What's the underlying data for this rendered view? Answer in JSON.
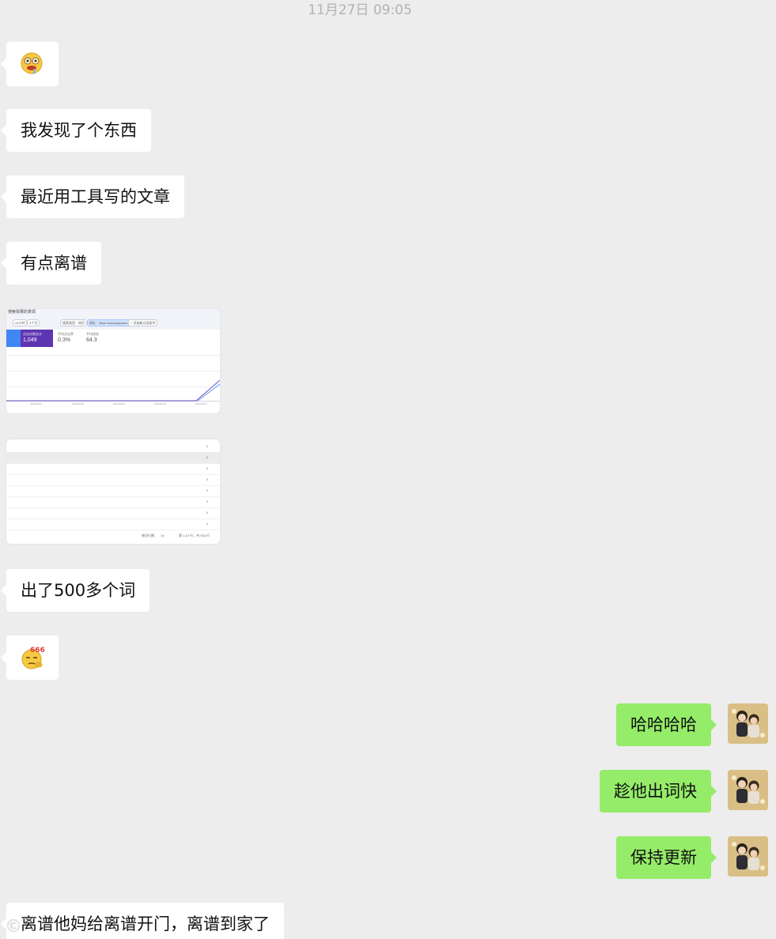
{
  "timestamp": "11月27日 09:05",
  "messages_in": {
    "m1": "我发现了个东西",
    "m2": "最近用工具写的文章",
    "m3": "有点离谱",
    "m4": "出了500多个词",
    "m5": "离谱他妈给离谱开门，离谱到家了"
  },
  "messages_out": {
    "m1": "哈哈哈哈",
    "m2": "趁他出词快",
    "m3": "保持更新"
  },
  "emojis": {
    "e1": "drooling-face-emoji",
    "e2": "666-thumbs-emoji"
  },
  "screenshot1": {
    "title": "搜索效果的表现",
    "chip_a": "24小时",
    "chip_b": "3个月",
    "chip_c": "搜索类型：网页",
    "chip_d": "网址：https://www.jiayuseo.",
    "chip_e": "+ 添加新过滤条件",
    "metric_clicks_label": "点击次数总计",
    "metric_clicks_value": "1,049",
    "metric_ctr_label": "平均点击率",
    "metric_ctr_value": "0.3%",
    "metric_pos_label": "平均排名",
    "metric_pos_value": "64.3",
    "axis": [
      "2023/11/01",
      "2023/11/05",
      "2023/11/09",
      "2023/11/13",
      "2023/11/17"
    ]
  },
  "screenshot2": {
    "row_values": [
      "0",
      "0",
      "0",
      "0",
      "0",
      "0",
      "0",
      "0"
    ],
    "rows_per_page_label": "每页行数：",
    "rows_per_page_value": "10",
    "range": "第 1-10 行，共 503 行"
  },
  "watermark": "©"
}
